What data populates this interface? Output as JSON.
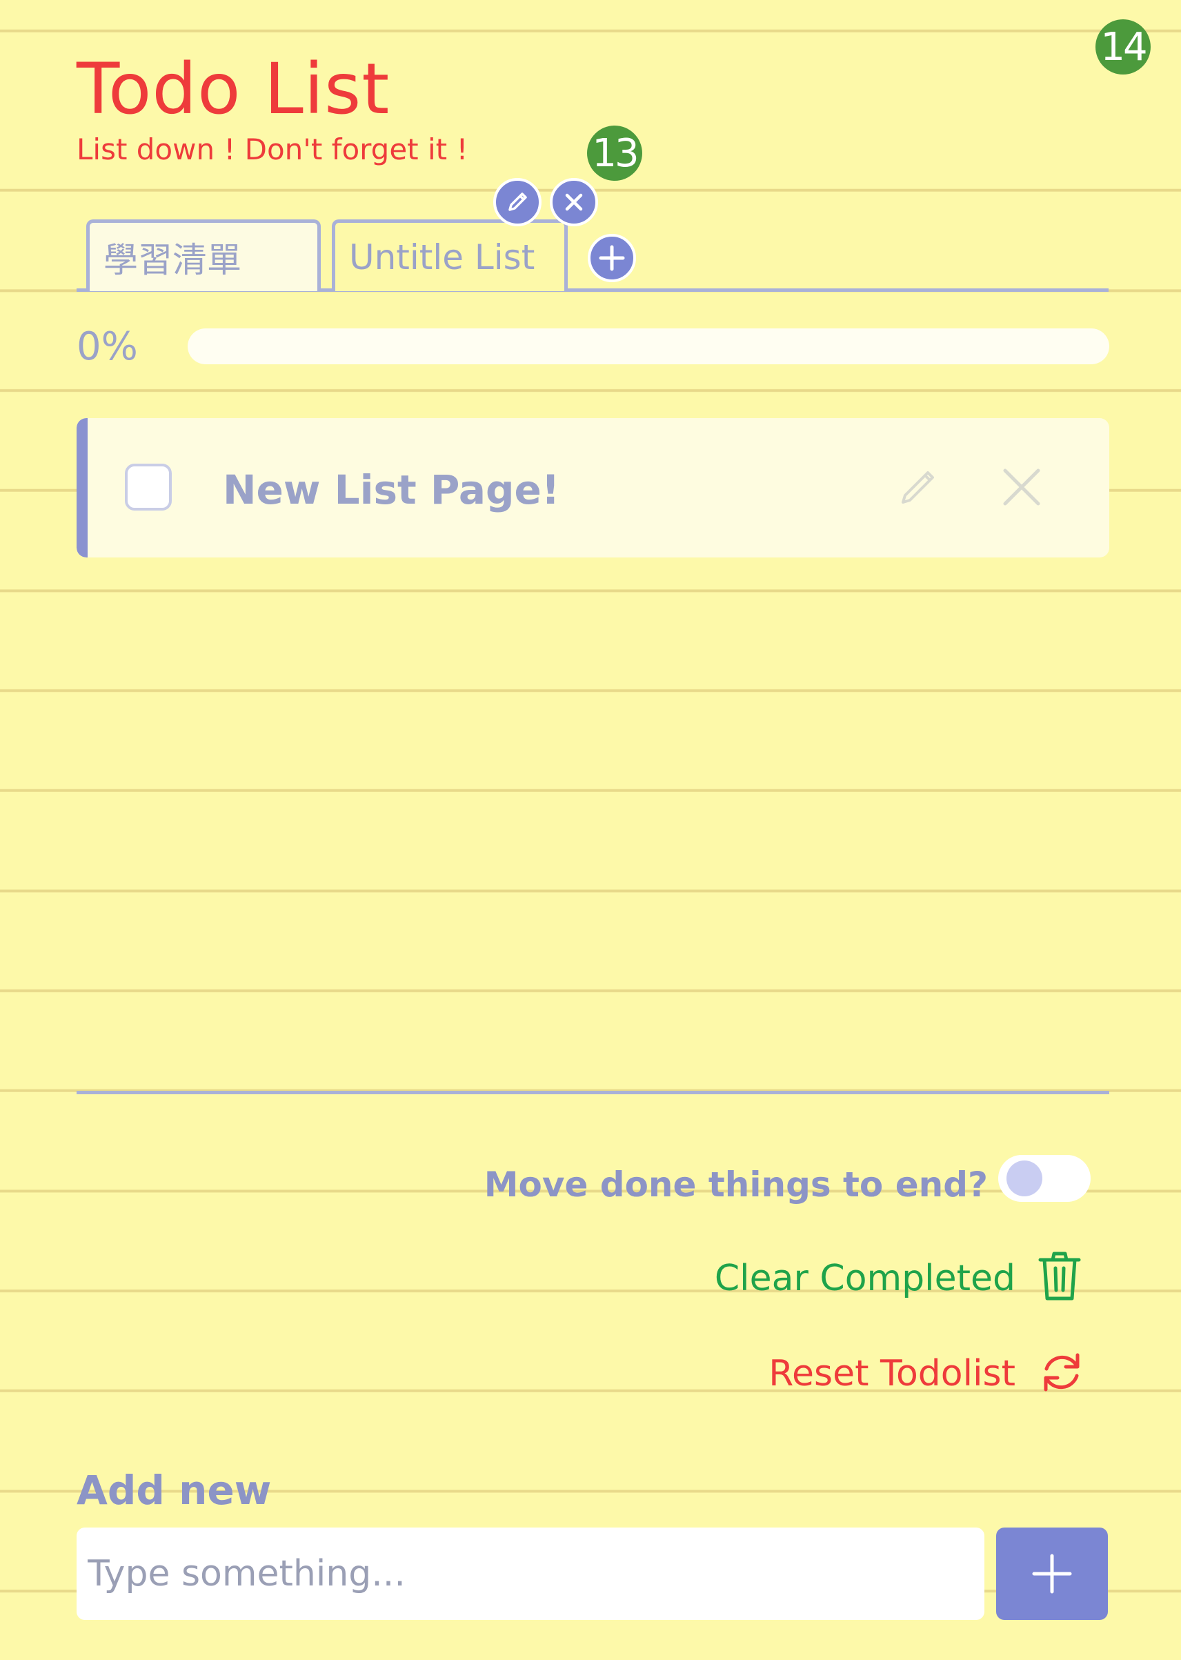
{
  "header": {
    "title": "Todo List",
    "subtitle": "List down ! Don't forget it !"
  },
  "markers": {
    "tab_actions": "13",
    "page": "14"
  },
  "tabs": [
    {
      "label": "學習清單",
      "active": false
    },
    {
      "label": "Untitle List",
      "active": true
    }
  ],
  "tab_actions": {
    "edit_icon": "pencil-icon",
    "delete_icon": "close-icon",
    "add_icon": "plus-icon"
  },
  "progress": {
    "label": "0%",
    "value": 0
  },
  "todos": [
    {
      "text": "New List Page!",
      "done": false
    }
  ],
  "options": {
    "move_done_label": "Move done things to end?",
    "move_done_enabled": false,
    "clear_completed_label": "Clear Completed",
    "reset_label": "Reset Todolist"
  },
  "add_new": {
    "heading": "Add new",
    "placeholder": "Type something..."
  },
  "colors": {
    "background": "#fdf9a9",
    "accent": "#7b86d3",
    "title": "#ee3b3b",
    "clear": "#1fa34a",
    "marker": "#4c9a3c"
  }
}
